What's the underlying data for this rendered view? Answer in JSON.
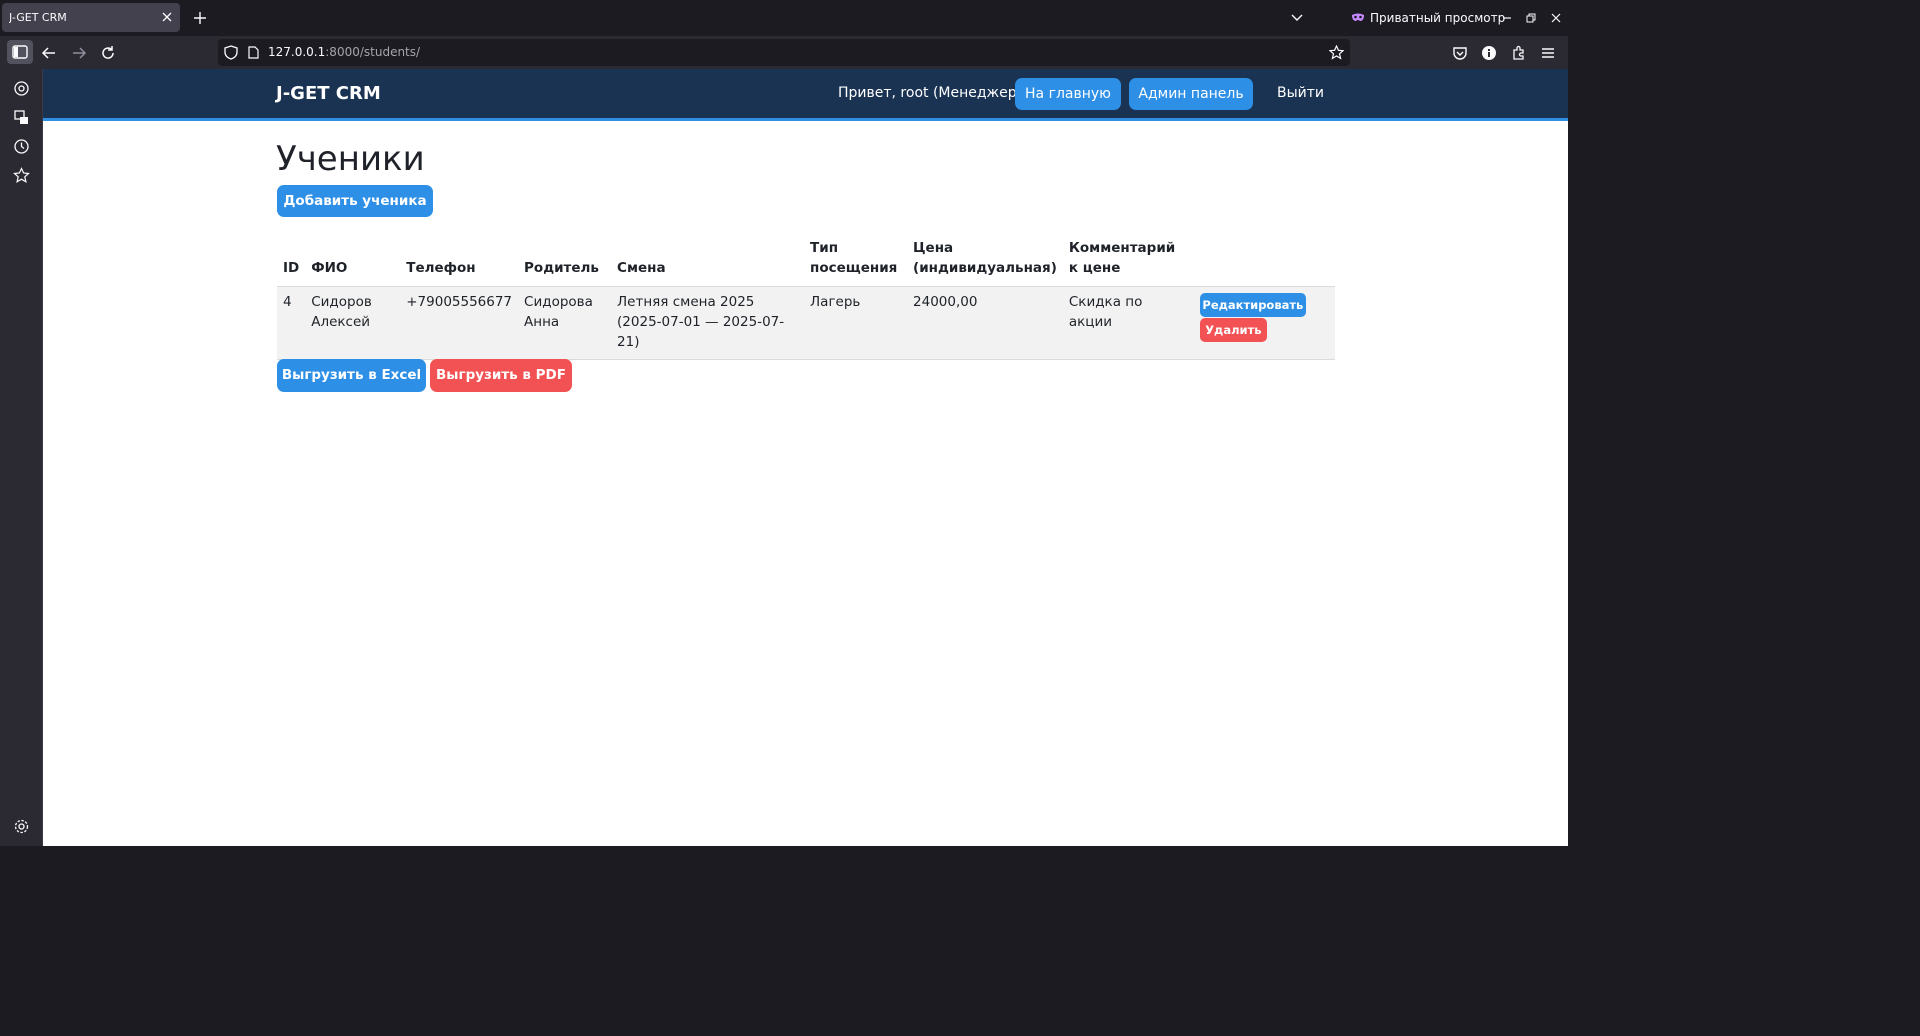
{
  "browser": {
    "tab_title": "J-GET CRM",
    "url_host": "127.0.0.1",
    "url_rest": ":8000/students/",
    "private_label": "Приватный просмотр"
  },
  "header": {
    "logo": "J-GET CRM",
    "greeting": "Привет, root (Менеджер)",
    "home_button": "На главную",
    "admin_button": "Админ панель",
    "logout": "Выйти"
  },
  "page_title": "Ученики",
  "add_button": "Добавить ученика",
  "table": {
    "columns": [
      "ID",
      "ФИО",
      "Телефон",
      "Родитель",
      "Смена",
      "Тип посещения",
      "Цена (индивидуальная)",
      "Комментарий к цене",
      ""
    ],
    "rows": [
      {
        "id": "4",
        "name": "Сидоров Алексей",
        "phone": "+79005556677",
        "parent": "Сидорова Анна",
        "shift": "Летняя смена 2025 (2025-07-01 — 2025-07-21)",
        "visit_type": "Лагерь",
        "price": "24000,00",
        "price_comment": "Скидка по акции",
        "edit_label": "Редактировать",
        "delete_label": "Удалить"
      }
    ]
  },
  "export": {
    "excel_label": "Выгрузить в Excel",
    "pdf_label": "Выгрузить в PDF"
  },
  "colors": {
    "header_bg": "#1a3353",
    "primary": "#2e8fe6",
    "danger": "#f25254"
  }
}
